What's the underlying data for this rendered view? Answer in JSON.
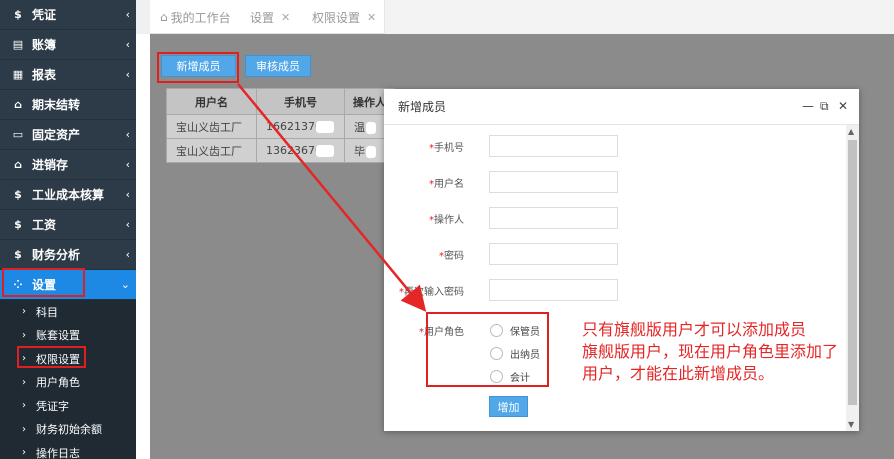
{
  "sidebar": {
    "items": [
      {
        "icon": "$",
        "label": "凭证"
      },
      {
        "icon": "▤",
        "label": "账簿"
      },
      {
        "icon": "▦",
        "label": "报表"
      },
      {
        "icon": "⌂",
        "label": "期末结转"
      },
      {
        "icon": "▭",
        "label": "固定资产"
      },
      {
        "icon": "⌂",
        "label": "进销存"
      },
      {
        "icon": "$",
        "label": "工业成本核算"
      },
      {
        "icon": "$",
        "label": "工资"
      },
      {
        "icon": "$",
        "label": "财务分析"
      }
    ],
    "active": {
      "icon": "⁘",
      "label": "设置"
    },
    "subitems": [
      "科目",
      "账套设置",
      "权限设置",
      "用户角色",
      "凭证字",
      "财务初始余额",
      "操作日志"
    ]
  },
  "tabs": [
    {
      "label": "我的工作台",
      "closable": false
    },
    {
      "label": "设置",
      "closable": true
    },
    {
      "label": "权限设置",
      "closable": true
    }
  ],
  "toolbar": {
    "add_member": "新增成员",
    "review_member": "审核成员"
  },
  "table": {
    "headers": [
      "用户名",
      "手机号",
      "操作人"
    ],
    "rows": [
      [
        "宝山义齿工厂",
        "16621370",
        "温"
      ],
      [
        "宝山义齿工厂",
        "13623670",
        "毕"
      ]
    ]
  },
  "dialog": {
    "title": "新增成员",
    "fields": [
      {
        "req": "*",
        "label": "手机号"
      },
      {
        "req": "*",
        "label": "用户名"
      },
      {
        "req": "*",
        "label": "操作人"
      },
      {
        "req": "*",
        "label": "密码"
      },
      {
        "req": "*",
        "label": "再次输入密码"
      }
    ],
    "role_label": "用户角色",
    "roles": [
      "保管员",
      "出纳员",
      "会计"
    ],
    "submit": "增加"
  },
  "annotation": {
    "lines": [
      "只有旗舰版用户才可以添加成员",
      "旗舰版用户，现在用户角色里添加了",
      "用户，才能在此新增成员。"
    ],
    "color": "#e52626"
  },
  "colors": {
    "sidebar_bg": "#2c3b47",
    "active": "#1e88e5",
    "button": "#52a7e8",
    "highlight": "#e02020"
  }
}
